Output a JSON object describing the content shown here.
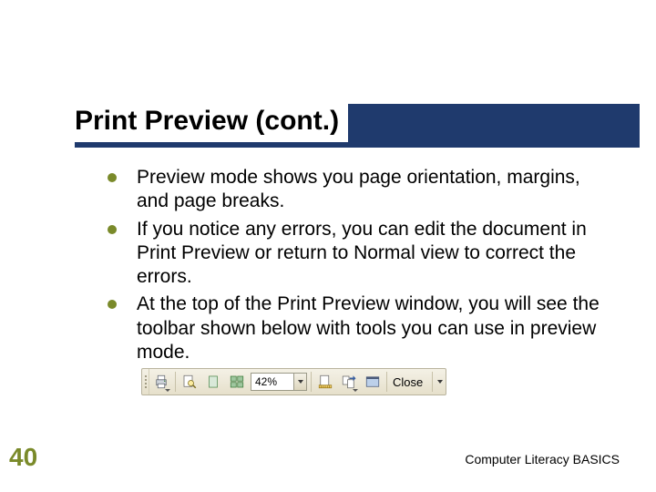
{
  "title": "Print Preview (cont.)",
  "bullets": [
    "Preview mode shows you page orientation, margins, and page breaks.",
    "If you notice any errors, you can edit the document in Print Preview or return to Normal view to correct the errors.",
    "At the top of the Print Preview window, you will see the toolbar shown below with tools you can use in preview mode."
  ],
  "toolbar": {
    "zoom_value": "42%",
    "close_label": "Close"
  },
  "page_number": "40",
  "footer": "Computer Literacy BASICS"
}
